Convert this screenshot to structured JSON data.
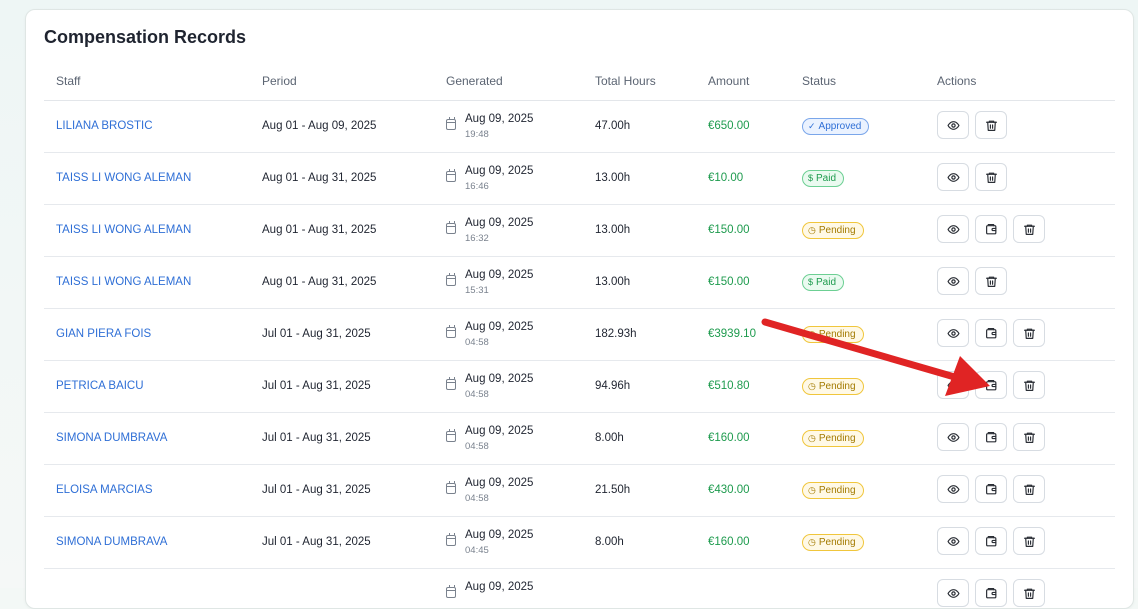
{
  "card": {
    "title": "Compensation Records"
  },
  "columns": {
    "staff": "Staff",
    "period": "Period",
    "generated": "Generated",
    "hours": "Total Hours",
    "amount": "Amount",
    "status": "Status",
    "actions": "Actions"
  },
  "rows": [
    {
      "staff": "LILIANA BROSTIC",
      "period": "Aug 01 - Aug 09, 2025",
      "gen_date": "Aug 09, 2025",
      "gen_time": "19:48",
      "hours": "47.00h",
      "amount": "€650.00",
      "status": "Approved",
      "status_type": "approved",
      "actions": [
        "view",
        "delete"
      ]
    },
    {
      "staff": "TAISS LI WONG ALEMAN",
      "period": "Aug 01 - Aug 31, 2025",
      "gen_date": "Aug 09, 2025",
      "gen_time": "16:46",
      "hours": "13.00h",
      "amount": "€10.00",
      "status": "Paid",
      "status_type": "paid",
      "actions": [
        "view",
        "delete"
      ]
    },
    {
      "staff": "TAISS LI WONG ALEMAN",
      "period": "Aug 01 - Aug 31, 2025",
      "gen_date": "Aug 09, 2025",
      "gen_time": "16:32",
      "hours": "13.00h",
      "amount": "€150.00",
      "status": "Pending",
      "status_type": "pending",
      "actions": [
        "view",
        "pay",
        "delete"
      ]
    },
    {
      "staff": "TAISS LI WONG ALEMAN",
      "period": "Aug 01 - Aug 31, 2025",
      "gen_date": "Aug 09, 2025",
      "gen_time": "15:31",
      "hours": "13.00h",
      "amount": "€150.00",
      "status": "Paid",
      "status_type": "paid",
      "actions": [
        "view",
        "delete"
      ]
    },
    {
      "staff": "GIAN PIERA FOIS",
      "period": "Jul 01 - Aug 31, 2025",
      "gen_date": "Aug 09, 2025",
      "gen_time": "04:58",
      "hours": "182.93h",
      "amount": "€3939.10",
      "status": "Pending",
      "status_type": "pending",
      "actions": [
        "view",
        "pay",
        "delete"
      ]
    },
    {
      "staff": "PETRICA BAICU",
      "period": "Jul 01 - Aug 31, 2025",
      "gen_date": "Aug 09, 2025",
      "gen_time": "04:58",
      "hours": "94.96h",
      "amount": "€510.80",
      "status": "Pending",
      "status_type": "pending",
      "actions": [
        "view",
        "pay",
        "delete"
      ]
    },
    {
      "staff": "SIMONA DUMBRAVA",
      "period": "Jul 01 - Aug 31, 2025",
      "gen_date": "Aug 09, 2025",
      "gen_time": "04:58",
      "hours": "8.00h",
      "amount": "€160.00",
      "status": "Pending",
      "status_type": "pending",
      "actions": [
        "view",
        "pay",
        "delete"
      ]
    },
    {
      "staff": "ELOISA MARCIAS",
      "period": "Jul 01 - Aug 31, 2025",
      "gen_date": "Aug 09, 2025",
      "gen_time": "04:58",
      "hours": "21.50h",
      "amount": "€430.00",
      "status": "Pending",
      "status_type": "pending",
      "actions": [
        "view",
        "pay",
        "delete"
      ]
    },
    {
      "staff": "SIMONA DUMBRAVA",
      "period": "Jul 01 - Aug 31, 2025",
      "gen_date": "Aug 09, 2025",
      "gen_time": "04:45",
      "hours": "8.00h",
      "amount": "€160.00",
      "status": "Pending",
      "status_type": "pending",
      "actions": [
        "view",
        "pay",
        "delete"
      ]
    },
    {
      "staff": "",
      "period": "",
      "gen_date": "Aug 09, 2025",
      "gen_time": "",
      "hours": "",
      "amount": "",
      "status": "",
      "status_type": "pending",
      "actions": [
        "view",
        "pay",
        "delete"
      ]
    }
  ],
  "icons": {
    "view": "eye-icon",
    "pay": "wallet-icon",
    "delete": "trash-icon",
    "calendar": "calendar-icon",
    "approved": "check-circle-icon",
    "paid": "dollar-icon",
    "pending": "clock-icon"
  },
  "colors": {
    "link": "#2f6fd6",
    "amount": "#1e9b4e",
    "approved": "#2f6fd6",
    "paid": "#1e9b4e",
    "pending": "#a37a00",
    "annotation_arrow": "#e02424"
  }
}
